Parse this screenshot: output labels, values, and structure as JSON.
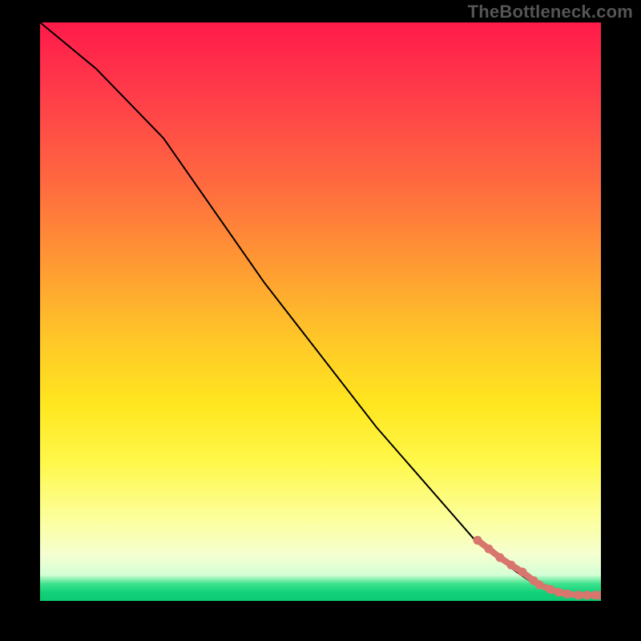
{
  "watermark": "TheBottleneck.com",
  "colors": {
    "gradient_top": "#ff1a4a",
    "gradient_mid": "#ffe61f",
    "gradient_green": "#12d17a",
    "curve": "#000000",
    "markers": "#d8766e",
    "frame": "#000000"
  },
  "chart_data": {
    "type": "line",
    "title": "",
    "xlabel": "",
    "ylabel": "",
    "xlim": [
      0,
      100
    ],
    "ylim": [
      0,
      100
    ],
    "series": [
      {
        "name": "bottleneck-curve",
        "x": [
          0,
          10,
          22,
          40,
          60,
          78,
          85,
          88,
          90,
          92,
          94,
          96,
          98,
          100
        ],
        "y": [
          100,
          92,
          80,
          55,
          30,
          10,
          5,
          3,
          2,
          1.5,
          1,
          1,
          1,
          1
        ]
      }
    ],
    "markers": {
      "name": "highlighted-points",
      "x": [
        78,
        80,
        82,
        84,
        86,
        88,
        89,
        91,
        92.5,
        94,
        96,
        97.5,
        99,
        100
      ],
      "y": [
        10.5,
        9,
        7.5,
        6.2,
        5,
        3.5,
        2.8,
        2,
        1.5,
        1.2,
        1,
        1,
        1,
        1
      ]
    }
  }
}
